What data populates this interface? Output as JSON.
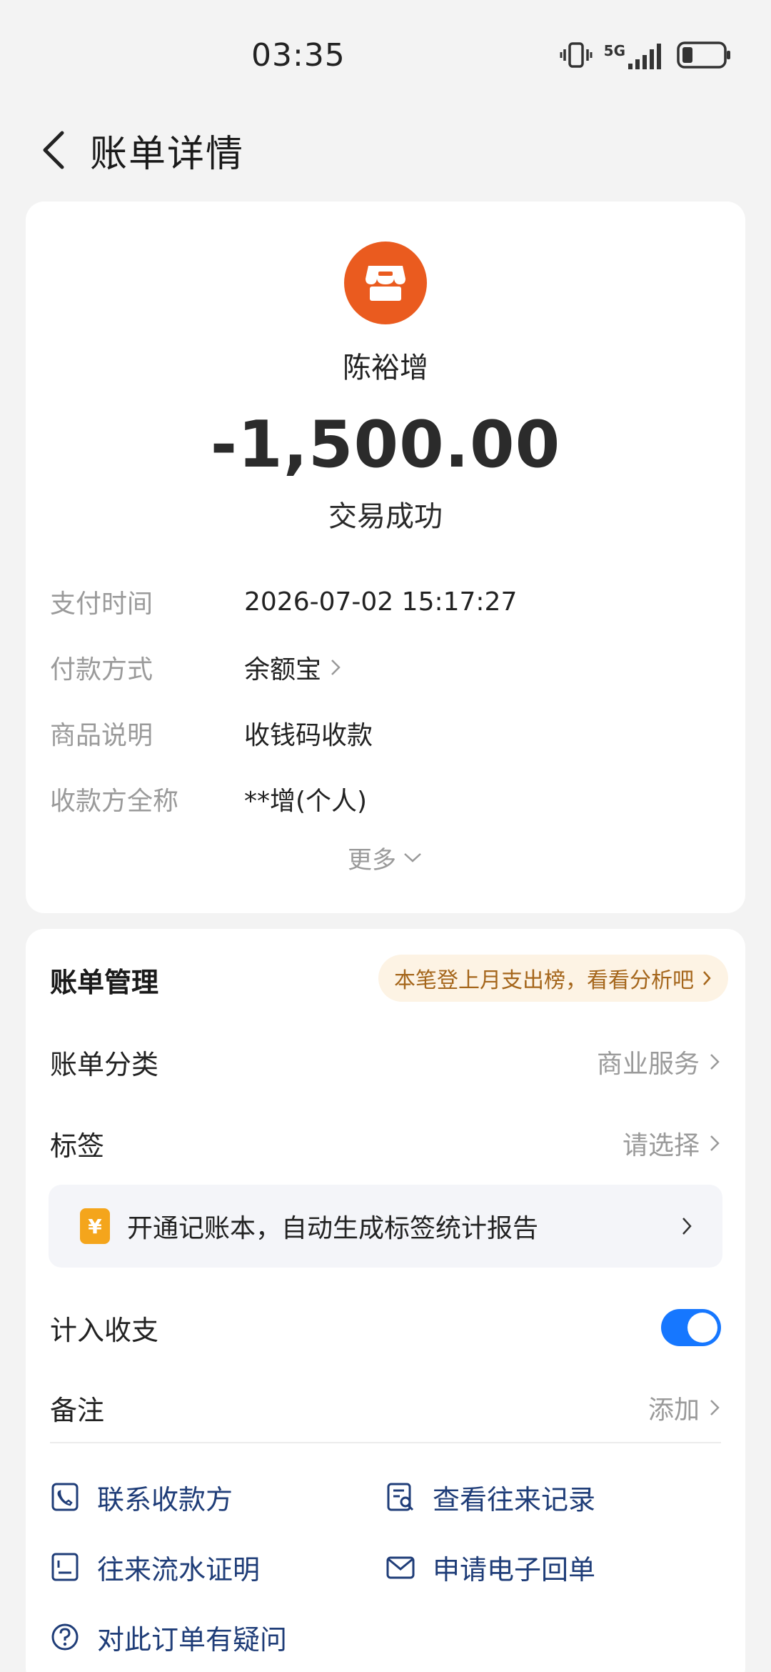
{
  "status_bar": {
    "time": "03:35",
    "network": "5G"
  },
  "header": {
    "title": "账单详情"
  },
  "merchant": {
    "name": "陈裕增"
  },
  "amount": "-1,500.00",
  "status": "交易成功",
  "details": [
    {
      "label": "支付时间",
      "value": "2026-07-02 15:17:27",
      "has_arrow": false
    },
    {
      "label": "付款方式",
      "value": "余额宝",
      "has_arrow": true
    },
    {
      "label": "商品说明",
      "value": "收钱码收款",
      "has_arrow": false
    },
    {
      "label": "收款方全称",
      "value": "**增(个人)",
      "has_arrow": false
    }
  ],
  "more": {
    "label": "更多"
  },
  "management": {
    "title": "账单管理",
    "promo": "本笔登上月支出榜，看看分析吧",
    "category": {
      "label": "账单分类",
      "value": "商业服务"
    },
    "tag": {
      "label": "标签",
      "value": "请选择"
    },
    "ledger_banner": {
      "icon_glyph": "¥",
      "text": "开通记账本，自动生成标签统计报告"
    },
    "count_in": {
      "label": "计入收支",
      "enabled": true
    },
    "note": {
      "label": "备注",
      "value": "添加"
    }
  },
  "actions": {
    "contact": "联系收款方",
    "history": "查看往来记录",
    "statement": "往来流水证明",
    "receipt": "申请电子回单",
    "question": "对此订单有疑问"
  },
  "colors": {
    "accent": "#1677ff",
    "merchant_logo": "#ea5b1f",
    "link": "#1f3d78",
    "promo_bg": "#fdf3e4",
    "promo_text": "#a5661b"
  }
}
